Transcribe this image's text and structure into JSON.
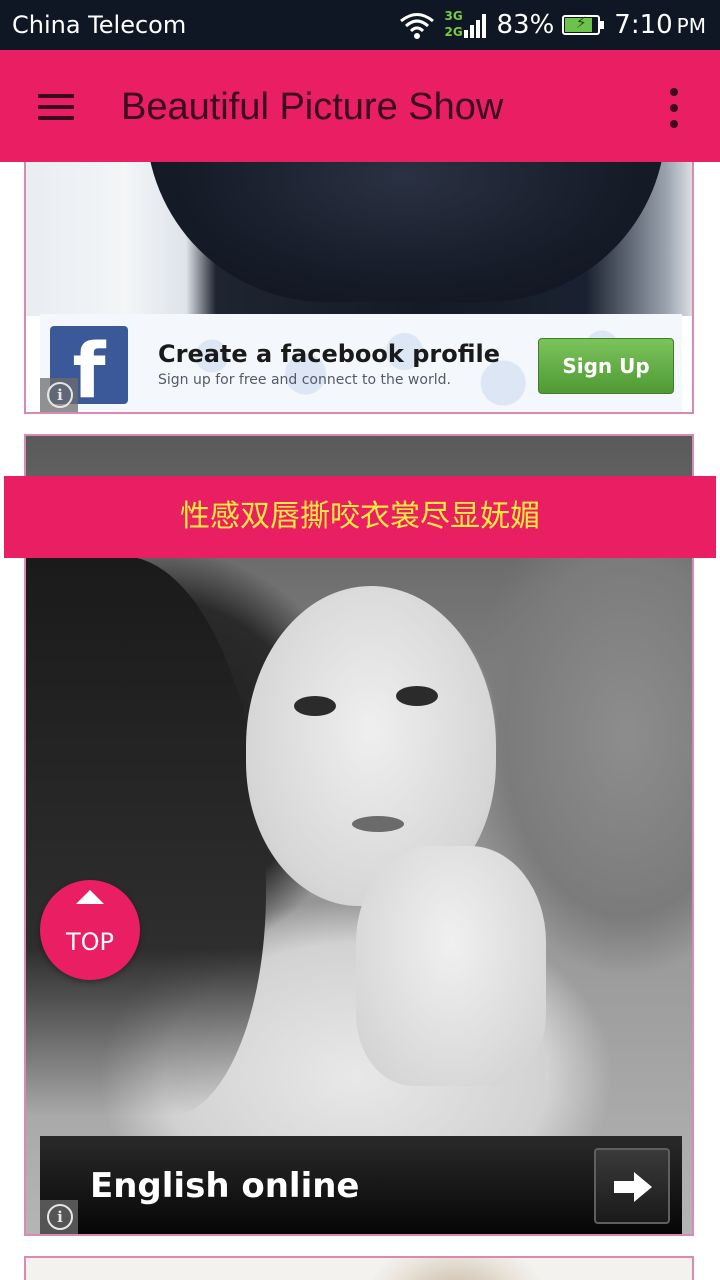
{
  "status_bar": {
    "carrier": "China Telecom",
    "network_top": "3G",
    "network_bottom": "2G",
    "battery_percent": "83%",
    "battery_level": 0.83,
    "time": "7:10",
    "ampm": "PM",
    "icons": [
      "wifi-icon",
      "signal-icon",
      "battery-charging-icon"
    ]
  },
  "app_bar": {
    "title": "Beautiful Picture Show",
    "menu_icon": "hamburger-menu-icon",
    "overflow_icon": "more-vert-icon",
    "color": "#e91e63",
    "text_color": "#3a0a1e"
  },
  "feed": {
    "ad_facebook": {
      "logo_letter": "f",
      "title": "Create a facebook profile",
      "subtitle": "Sign up for free and connect to the world.",
      "button_label": "Sign Up"
    },
    "caption": "性感双唇撕咬衣裳尽显妩媚",
    "caption_color": "#ffeb3b",
    "ad_english": {
      "label": "English online",
      "icon": "arrow-right-icon"
    }
  },
  "top_button": {
    "label": "TOP",
    "icon": "arrow-up-icon"
  }
}
